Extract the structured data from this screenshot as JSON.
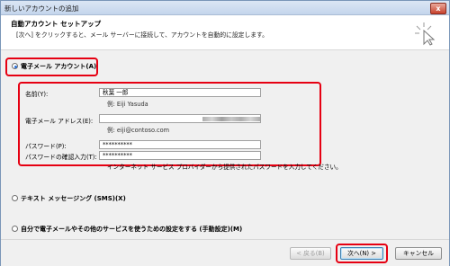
{
  "window": {
    "title": "新しいアカウントの追加",
    "close_glyph": "x"
  },
  "header": {
    "title": "自動アカウント セットアップ",
    "description": "[次へ] をクリックすると、メール サーバーに接続して、アカウントを自動的に設定します。"
  },
  "options": {
    "email_account": "電子メール アカウント(A)",
    "sms": "テキスト メッセージング (SMS)(X)",
    "manual": "自分で電子メールやその他のサービスを使うための設定をする (手動設定)(M)"
  },
  "form": {
    "name_label": "名前(Y):",
    "name_value": "秋葉 一郎",
    "name_example": "例: Eiji Yasuda",
    "email_label": "電子メール アドレス(E):",
    "email_example": "例: eiji@contoso.com",
    "password_label": "パスワード(P):",
    "password_value": "**********",
    "password_confirm_label": "パスワードの確認入力(T):",
    "password_confirm_value": "**********",
    "password_note": "インターネット サービス プロバイダーから提供されたパスワードを入力してください。"
  },
  "buttons": {
    "back": "< 戻る(B)",
    "next": "次へ(N) >",
    "cancel": "キャンセル"
  },
  "colors": {
    "highlight": "#e60012",
    "accent": "#2a6fd6"
  }
}
